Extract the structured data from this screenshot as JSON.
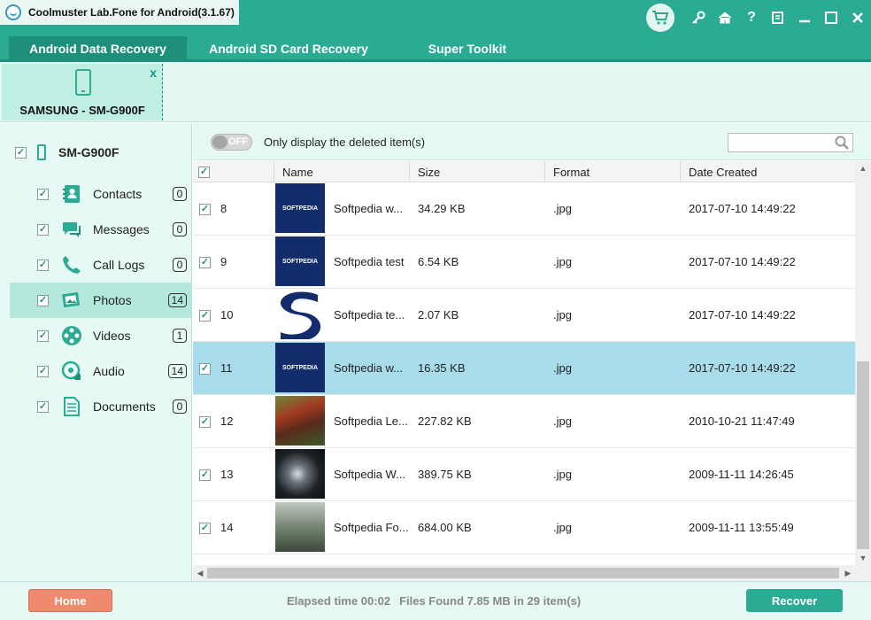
{
  "window": {
    "title": "Coolmuster Lab.Fone for Android(3.1.67)",
    "controls": [
      "cart-icon",
      "key-icon",
      "home-icon",
      "help-icon",
      "feedback-icon",
      "minimize-icon",
      "maximize-icon",
      "close-icon"
    ]
  },
  "tabs": [
    {
      "label": "Android Data Recovery",
      "active": true
    },
    {
      "label": "Android SD Card Recovery",
      "active": false
    },
    {
      "label": "Super Toolkit",
      "active": false
    }
  ],
  "device": {
    "name": "SAMSUNG - SM-G900F",
    "close": "x"
  },
  "sidebar": {
    "root": {
      "label": "SM-G900F",
      "checked": true
    },
    "items": [
      {
        "label": "Contacts",
        "count": "0",
        "icon": "contacts-icon"
      },
      {
        "label": "Messages",
        "count": "0",
        "icon": "messages-icon"
      },
      {
        "label": "Call Logs",
        "count": "0",
        "icon": "phone-icon"
      },
      {
        "label": "Photos",
        "count": "14",
        "icon": "photos-icon",
        "selected": true
      },
      {
        "label": "Videos",
        "count": "1",
        "icon": "videos-icon"
      },
      {
        "label": "Audio",
        "count": "14",
        "icon": "audio-icon"
      },
      {
        "label": "Documents",
        "count": "0",
        "icon": "documents-icon"
      }
    ]
  },
  "filter": {
    "toggle": "OFF",
    "label": "Only display the deleted item(s)",
    "search_placeholder": ""
  },
  "table": {
    "columns": [
      "Name",
      "Size",
      "Format",
      "Date Created"
    ],
    "rows": [
      {
        "num": "8",
        "name": "Softpedia w...",
        "size": "34.29 KB",
        "format": ".jpg",
        "date": "2017-07-10 14:49:22",
        "thumb": "softpedia-logo"
      },
      {
        "num": "9",
        "name": "Softpedia test",
        "size": "6.54 KB",
        "format": ".jpg",
        "date": "2017-07-10 14:49:22",
        "thumb": "softpedia-logo"
      },
      {
        "num": "10",
        "name": "Softpedia te...",
        "size": "2.07 KB",
        "format": ".jpg",
        "date": "2017-07-10 14:49:22",
        "thumb": "softpedia-s"
      },
      {
        "num": "11",
        "name": "Softpedia w...",
        "size": "16.35 KB",
        "format": ".jpg",
        "date": "2017-07-10 14:49:22",
        "thumb": "softpedia-logo",
        "selected": true
      },
      {
        "num": "12",
        "name": "Softpedia Le...",
        "size": "227.82 KB",
        "format": ".jpg",
        "date": "2010-10-21 11:47:49",
        "thumb": "leaves"
      },
      {
        "num": "13",
        "name": "Softpedia W...",
        "size": "389.75 KB",
        "format": ".jpg",
        "date": "2009-11-11 14:26:45",
        "thumb": "dark-wallpaper"
      },
      {
        "num": "14",
        "name": "Softpedia Fo...",
        "size": "684.00 KB",
        "format": ".jpg",
        "date": "2009-11-11 13:55:49",
        "thumb": "forest"
      }
    ]
  },
  "footer": {
    "home": "Home",
    "elapsed": "Elapsed time 00:02",
    "found": "Files Found 7.85 MB in 29 item(s)",
    "recover": "Recover"
  },
  "thumb_text": "SOFTPEDIA",
  "colors": {
    "accent": "#2bab94",
    "accent_dark": "#1e8f7a",
    "home": "#f08a6e",
    "selection": "#a8dceb",
    "logo_bg": "#132c6b"
  }
}
